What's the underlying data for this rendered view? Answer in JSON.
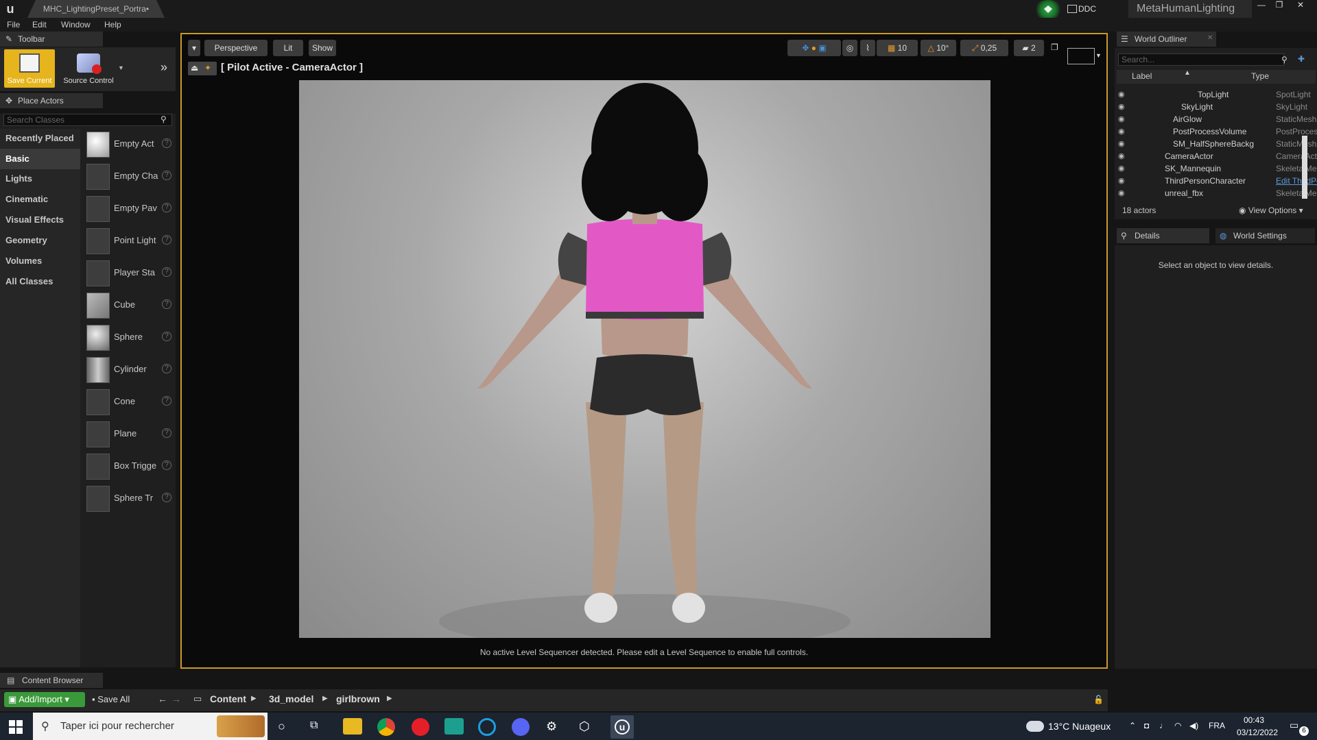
{
  "titlebar": {
    "tab": "MHC_LightingPreset_Portra•",
    "ddc": "DDC",
    "project": "MetaHumanLighting"
  },
  "menu": [
    "File",
    "Edit",
    "Window",
    "Help"
  ],
  "toolbar_panel": {
    "tab": "Toolbar",
    "save": "Save Current",
    "source_control": "Source Control"
  },
  "place_actors": {
    "tab": "Place Actors",
    "search_placeholder": "Search Classes",
    "categories": [
      "Recently Placed",
      "Basic",
      "Lights",
      "Cinematic",
      "Visual Effects",
      "Geometry",
      "Volumes",
      "All Classes"
    ],
    "actors": [
      "Empty Act",
      "Empty Cha",
      "Empty Pav",
      "Point Light",
      "Player Sta",
      "Cube",
      "Sphere",
      "Cylinder",
      "Cone",
      "Plane",
      "Box Trigge",
      "Sphere Tr"
    ]
  },
  "viewport": {
    "perspective": "Perspective",
    "lit": "Lit",
    "show": "Show",
    "grid": "10",
    "rot": "10°",
    "scale": "0,25",
    "cam": "2",
    "pilot": "[ Pilot Active - CameraActor ]",
    "sequencer_note": "No active Level Sequencer detected. Please edit a Level Sequence to enable full controls."
  },
  "outliner": {
    "tab": "World Outliner",
    "search_placeholder": "Search...",
    "col_label": "Label",
    "col_type": "Type",
    "rows": [
      {
        "label": "TopLight",
        "type": "SpotLight"
      },
      {
        "label": "SkyLight",
        "type": "SkyLight"
      },
      {
        "label": "AirGlow",
        "type": "StaticMeshAc"
      },
      {
        "label": "PostProcessVolume",
        "type": "PostProcess\\"
      },
      {
        "label": "SM_HalfSphereBackg",
        "type": "StaticMeshAc"
      },
      {
        "label": "CameraActor",
        "type": "CameraActor"
      },
      {
        "label": "SK_Mannequin",
        "type": "SkeletalMesh"
      },
      {
        "label": "ThirdPersonCharacter",
        "type": "Edit ThirdPe"
      },
      {
        "label": "unreal_fbx",
        "type": "SkeletalMesh"
      }
    ],
    "count": "18 actors",
    "view_options": "View Options"
  },
  "details": {
    "tab": "Details",
    "world_settings": "World Settings",
    "empty": "Select an object to view details."
  },
  "content_browser": {
    "tab": "Content Browser",
    "add_import": "Add/Import",
    "save_all": "Save All",
    "path": [
      "Content",
      "3d_model",
      "girlbrown"
    ]
  },
  "taskbar": {
    "search_placeholder": "Taper ici pour rechercher",
    "weather": "13°C  Nuageux",
    "lang": "FRA",
    "time": "00:43",
    "date": "03/12/2022",
    "notifications": "6"
  }
}
